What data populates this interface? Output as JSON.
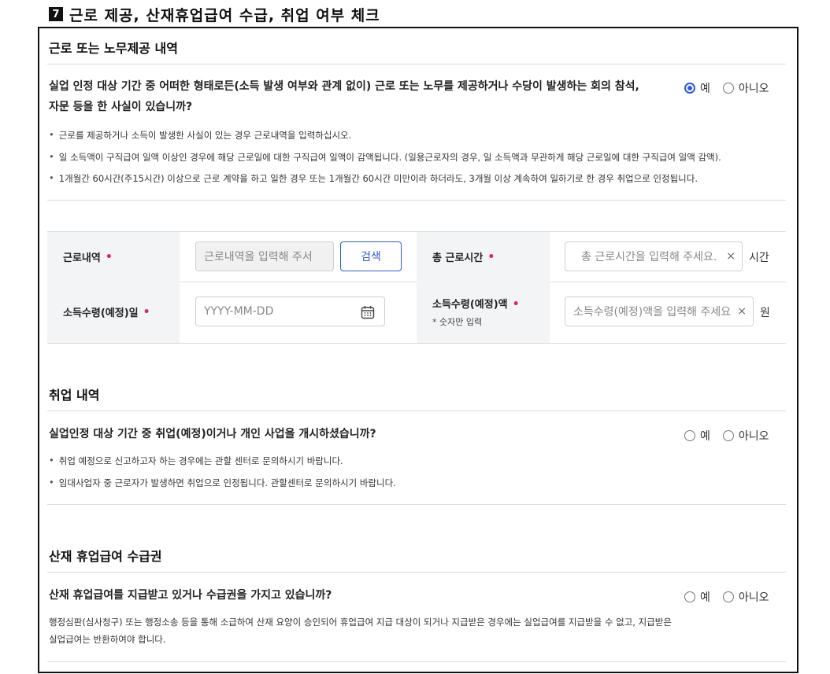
{
  "heading": {
    "number": "7",
    "title": "근로 제공, 산재휴업급여 수급, 취업 여부 체크"
  },
  "work": {
    "title": "근로 또는 노무제공 내역",
    "question_line1": "실업 인정 대상 기간 중 어떠한 형태로든(소득 발생 여부와 관계 없이) 근로 또는 노무를 제공하거나 수당이 발생하는 회의 참석,",
    "question_line2": "자문 등을 한 사실이 있습니까?",
    "radio_yes": "예",
    "radio_no": "아니오",
    "selected": "예",
    "bullets": [
      "근로를 제공하거나 소득이 발생한 사실이 있는 경우 근로내역을 입력하십시오.",
      "일 소득액이 구직급여 일액 이상인 경우에 해당 근로일에 대한 구직급여 일액이 감액됩니다. (일용근로자의 경우, 일 소득액과 무관하게 해당 근로일에 대한 구직급여 일액 감액).",
      "1개월간 60시간(주15시간) 이상으로 근로 계약을 하고 일한 경우 또는 1개월간 60시간 미만이라 하더라도, 3개월 이상 계속하여 일하기로 한 경우 취업으로 인정됩니다."
    ]
  },
  "form": {
    "work_details_label": "근로내역",
    "work_details_placeholder": "근로내역을 입력해 주서",
    "search_button": "검색",
    "total_hours_label": "총 근로시간",
    "total_hours_placeholder": "총 근로시간을 입력해 주세요.",
    "hours_unit": "시간",
    "income_date_label": "소득수령(예정)일",
    "income_date_placeholder": "YYYY-MM-DD",
    "income_amount_label": "소득수령(예정)액",
    "income_amount_note": "* 숫자만 입력",
    "income_amount_placeholder": "소득수령(예정)액을 입력해 주세요",
    "amount_unit": "원",
    "clear_icon": "×",
    "required_mark": "•"
  },
  "employment": {
    "title": "취업 내역",
    "question": "실업인정 대상 기간 중 취업(예정)이거나 개인 사업을 개시하셨습니까?",
    "radio_yes": "예",
    "radio_no": "아니오",
    "bullets": [
      "취업 예정으로 신고하고자 하는 경우에는 관할 센터로 문의하시기 바랍니다.",
      "임대사업자 중 근로자가 발생하면 취업으로 인정됩니다. 관할센터로 문의하시기 바랍니다."
    ]
  },
  "industrial": {
    "title": "산재 휴업급여 수급권",
    "question": "산재 휴업급여를 지급받고 있거나 수급권을 가지고 있습니까?",
    "radio_yes": "예",
    "radio_no": "아니오",
    "note_line1": "행정심판(심사청구) 또는 행정소송 등을 통해 소급하여 산재 요양이 승인되어 휴업급여 지급 대상이 되거나 지급받은 경우에는 실업급여를 지급받을 수 없고, 지급받은",
    "note_line2": "실업급여는 반환하여야 합니다."
  },
  "colors": {
    "accent": "#2f5bd8",
    "required": "#e0245e",
    "label_bg": "#f3f4f6"
  }
}
